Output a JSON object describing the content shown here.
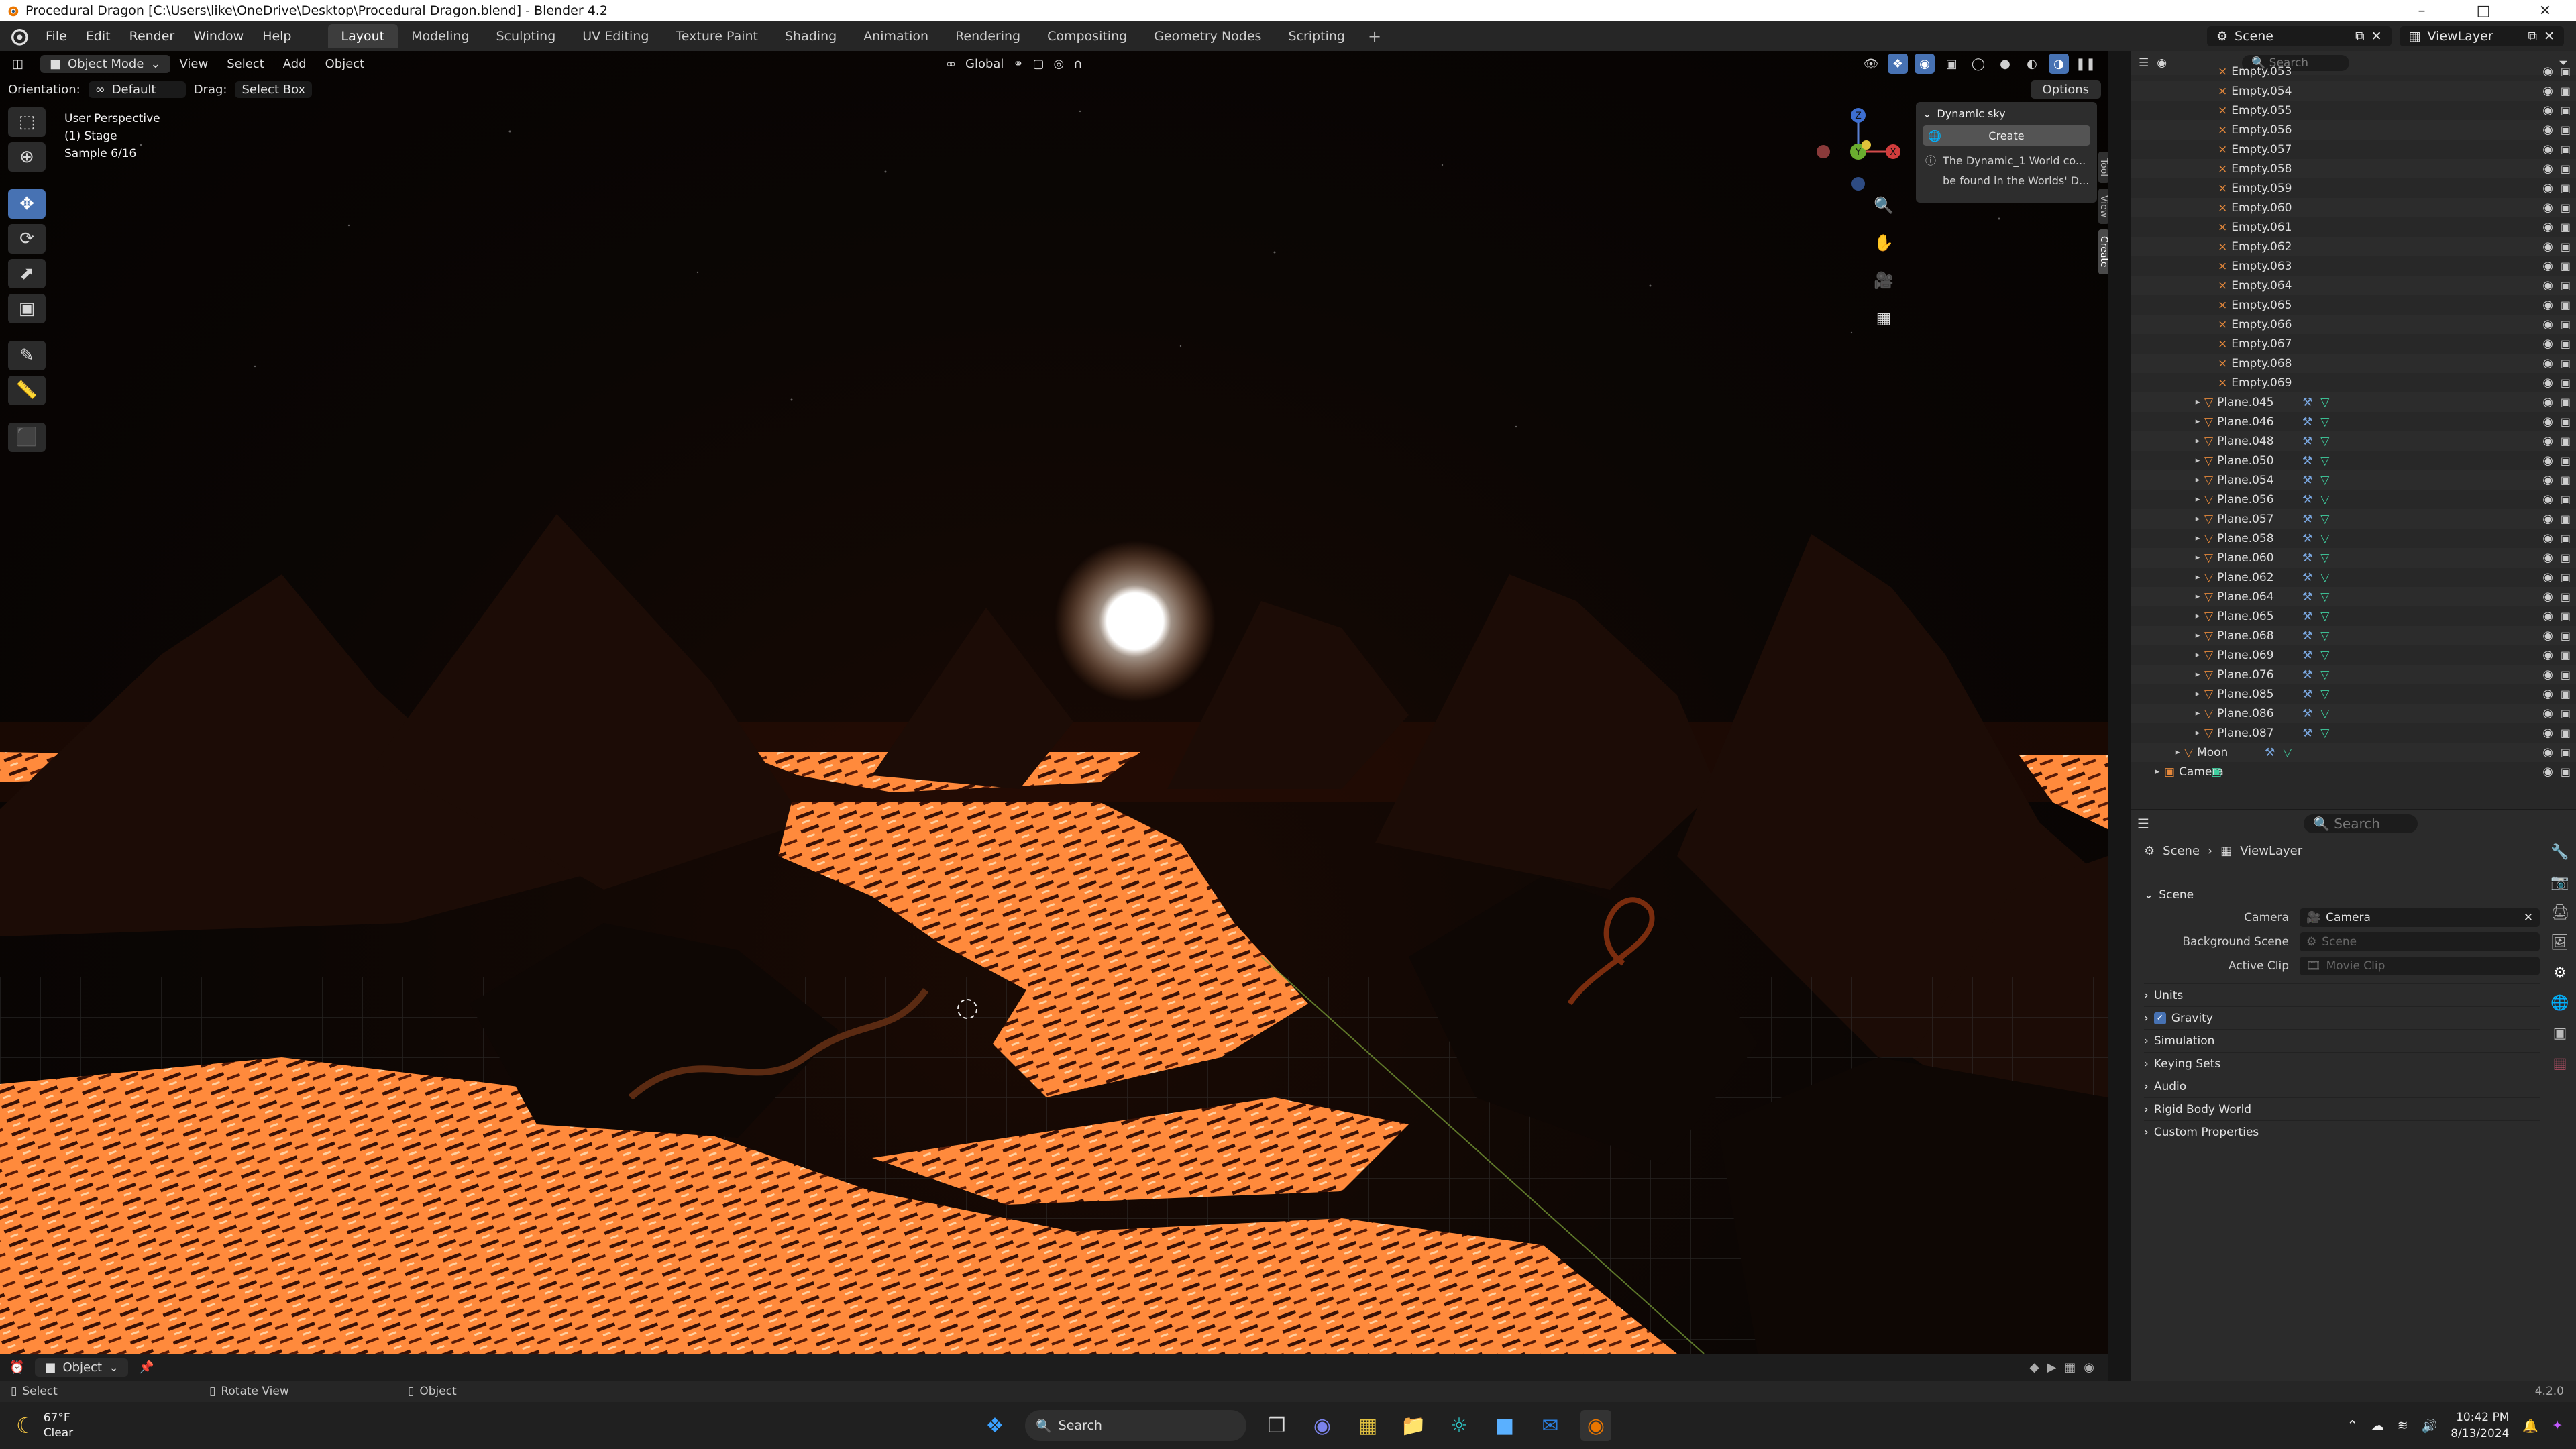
{
  "window": {
    "title": "Procedural Dragon [C:\\Users\\like\\OneDrive\\Desktop\\Procedural Dragon.blend] - Blender 4.2",
    "minimize": "–",
    "maximize": "□",
    "close": "✕"
  },
  "menu": {
    "items": [
      "File",
      "Edit",
      "Render",
      "Window",
      "Help"
    ],
    "workspaces": [
      "Layout",
      "Modeling",
      "Sculpting",
      "UV Editing",
      "Texture Paint",
      "Shading",
      "Animation",
      "Rendering",
      "Compositing",
      "Geometry Nodes",
      "Scripting"
    ],
    "active_workspace": "Layout",
    "scene_label": "Scene",
    "viewlayer_label": "ViewLayer"
  },
  "viewport_header": {
    "mode": "Object Mode",
    "menus": [
      "View",
      "Select",
      "Add",
      "Object"
    ],
    "transform_orientation": "Global",
    "search_placeholder": "Search"
  },
  "tool_header": {
    "orientation_label": "Orientation:",
    "orientation_value": "Default",
    "drag_label": "Drag:",
    "drag_value": "Select Box",
    "options": "Options"
  },
  "overlay": {
    "line1": "User Perspective",
    "line2": "(1) Stage",
    "line3": "Sample 6/16"
  },
  "npanel": {
    "title": "Dynamic sky",
    "create_button": "Create",
    "info1": "The Dynamic_1 World co...",
    "info2": "be found in the Worlds' D...",
    "tabs": [
      "Tool",
      "View",
      "Create"
    ]
  },
  "gizmo": {
    "z": "Z",
    "y": "Y",
    "x": "X"
  },
  "viewport_bottom": {
    "object_label": "Object"
  },
  "statusbar": {
    "select": "Select",
    "rotate": "Rotate View",
    "object": "Object",
    "version": "4.2.0"
  },
  "outliner": {
    "search_placeholder": "Search",
    "empties": [
      "Empty.053",
      "Empty.054",
      "Empty.055",
      "Empty.056",
      "Empty.057",
      "Empty.058",
      "Empty.059",
      "Empty.060",
      "Empty.061",
      "Empty.062",
      "Empty.063",
      "Empty.064",
      "Empty.065",
      "Empty.066",
      "Empty.067",
      "Empty.068",
      "Empty.069"
    ],
    "planes": [
      "Plane.045",
      "Plane.046",
      "Plane.048",
      "Plane.050",
      "Plane.054",
      "Plane.056",
      "Plane.057",
      "Plane.058",
      "Plane.060",
      "Plane.062",
      "Plane.064",
      "Plane.065",
      "Plane.068",
      "Plane.069",
      "Plane.076",
      "Plane.085",
      "Plane.086",
      "Plane.087"
    ],
    "moon": "Moon",
    "camera": "Camera"
  },
  "properties": {
    "search_placeholder": "Search",
    "breadcrumb_scene": "Scene",
    "breadcrumb_viewlayer": "ViewLayer",
    "scene_section": "Scene",
    "camera_label": "Camera",
    "camera_value": "Camera",
    "background_label": "Background Scene",
    "background_placeholder": "Scene",
    "clip_label": "Active Clip",
    "clip_placeholder": "Movie Clip",
    "sections": [
      "Units",
      "Gravity",
      "Simulation",
      "Keying Sets",
      "Audio",
      "Rigid Body World",
      "Custom Properties"
    ],
    "gravity_checked": true
  },
  "taskbar": {
    "temperature": "67°F",
    "condition": "Clear",
    "search_placeholder": "Search",
    "time": "10:42 PM",
    "date": "8/13/2024"
  },
  "colors": {
    "accent": "#4772b3",
    "lava": "#ff8a3c",
    "empty_icon": "#e5883b",
    "modifier_icon": "#7aa7e0",
    "mesh_data_icon": "#3fcfa0"
  }
}
